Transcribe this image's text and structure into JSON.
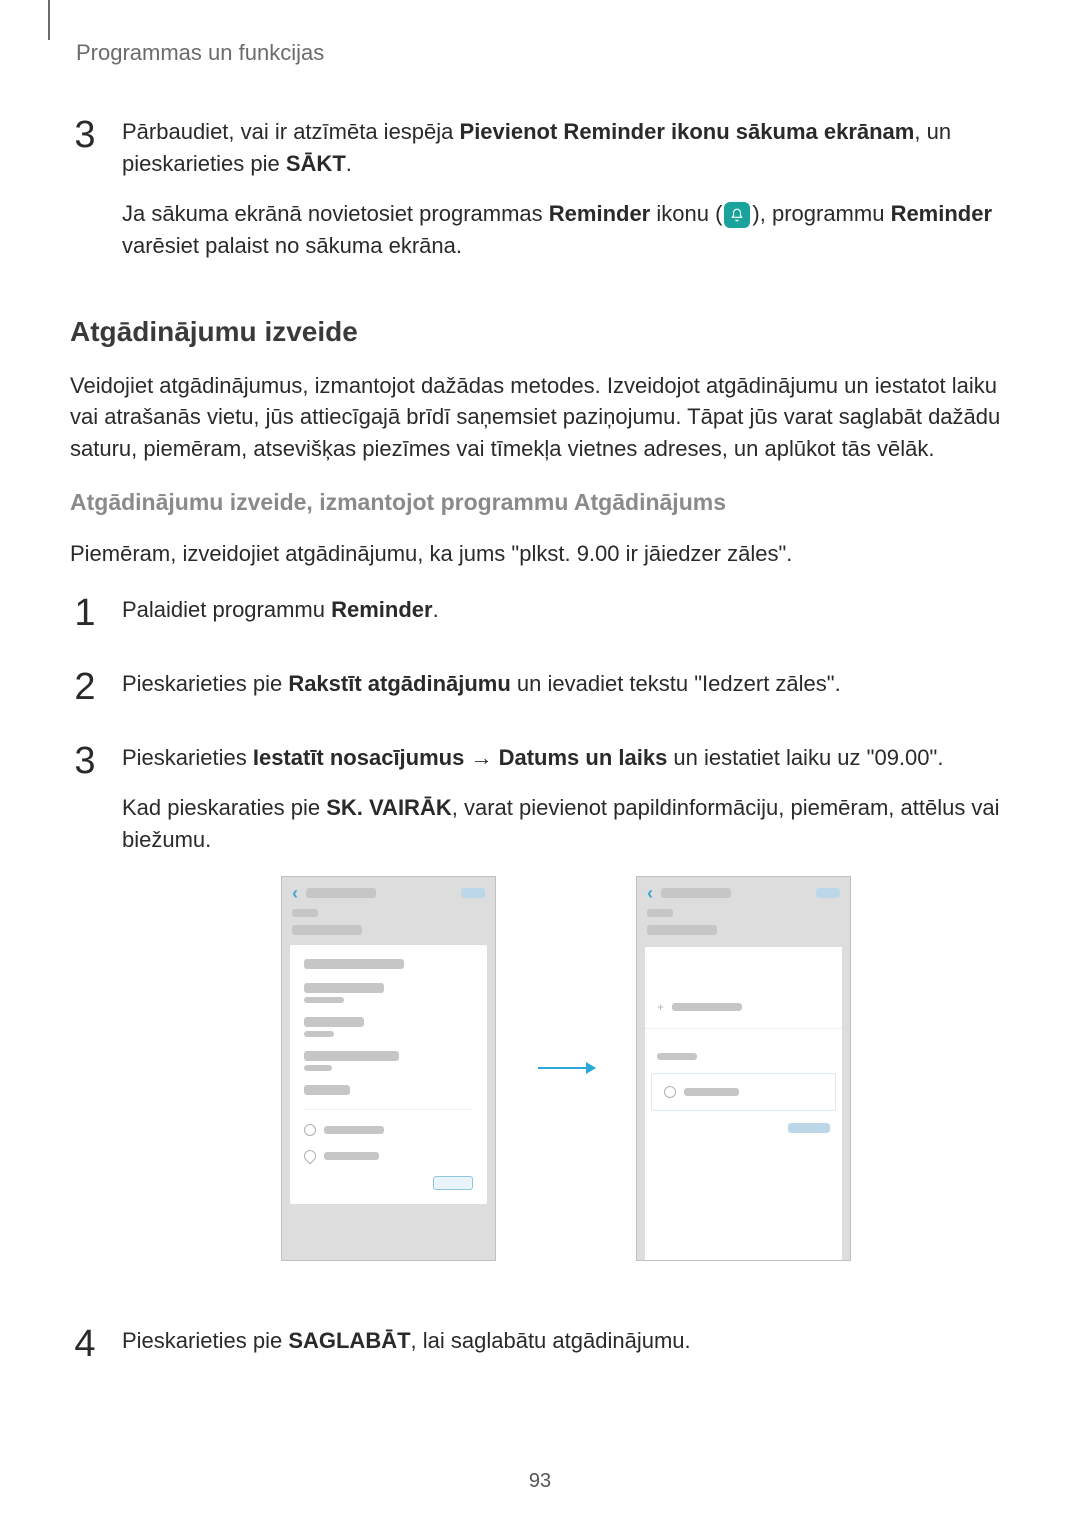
{
  "header": {
    "breadcrumb": "Programmas un funkcijas"
  },
  "step3a": {
    "num": "3",
    "p1_pre": "Pārbaudiet, vai ir atzīmēta iespēja ",
    "p1_bold1": "Pievienot Reminder ikonu sākuma ekrānam",
    "p1_mid": ", un pieskarieties pie ",
    "p1_bold2": "SĀKT",
    "p1_end": ".",
    "p2_pre": "Ja sākuma ekrānā novietosiet programmas ",
    "p2_b1": "Reminder",
    "p2_mid1": " ikonu (",
    "p2_mid2": "), programmu ",
    "p2_b2": "Reminder",
    "p2_end": " varēsiet palaist no sākuma ekrāna."
  },
  "section": {
    "h2": "Atgādinājumu izveide",
    "intro": "Veidojiet atgādinājumus, izmantojot dažādas metodes. Izveidojot atgādinājumu un iestatot laiku vai atrašanās vietu, jūs attiecīgajā brīdī saņemsiet paziņojumu. Tāpat jūs varat saglabāt dažādu saturu, piemēram, atsevišķas piezīmes vai tīmekļa vietnes adreses, un aplūkot tās vēlāk.",
    "h3": "Atgādinājumu izveide, izmantojot programmu Atgādinājums",
    "example": "Piemēram, izveidojiet atgādinājumu, ka jums \"plkst. 9.00 ir jāiedzer zāles\"."
  },
  "step1": {
    "num": "1",
    "pre": "Palaidiet programmu ",
    "bold": "Reminder",
    "end": "."
  },
  "step2": {
    "num": "2",
    "pre": "Pieskarieties pie ",
    "bold": "Rakstīt atgādinājumu",
    "end": " un ievadiet tekstu \"Iedzert zāles\"."
  },
  "step3b": {
    "num": "3",
    "p1_pre": "Pieskarieties ",
    "p1_b1": "Iestatīt nosacījumus",
    "p1_arrow": " → ",
    "p1_b2": "Datums un laiks",
    "p1_end": " un iestatiet laiku uz \"09.00\".",
    "p2_pre": "Kad pieskaraties pie ",
    "p2_b": "SK. VAIRĀK",
    "p2_end": ", varat pievienot papildinformāciju, piemēram, attēlus vai biežumu."
  },
  "step4": {
    "num": "4",
    "pre": "Pieskarieties pie ",
    "bold": "SAGLABĀT",
    "end": ", lai saglabātu atgādinājumu."
  },
  "pageNumber": "93",
  "icons": {
    "reminder": "reminder-bell-icon",
    "arrow_right": "arrow-right-icon",
    "chev_left": "chevron-left-icon",
    "clock": "clock-icon",
    "pin": "location-pin-icon"
  }
}
